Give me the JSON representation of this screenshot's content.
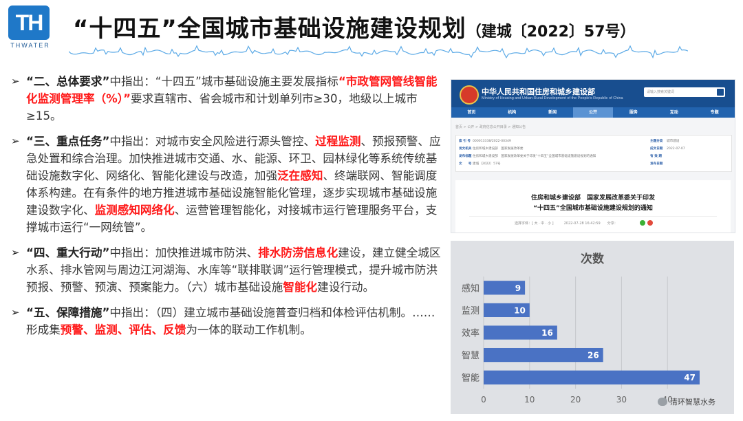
{
  "logo": {
    "mark": "TH",
    "text": "THWATER",
    "color": "#1f78c8"
  },
  "title": {
    "main": "“十四五”全国城市基础设施建设规划",
    "sub": "（建城〔2022〕57号）"
  },
  "paragraphs": [
    [
      {
        "t": "“二、总体要求”",
        "s": "bold"
      },
      {
        "t": "中指出：“十四五”城市基础设施主要发展指标",
        "s": ""
      },
      {
        "t": "“市政管网管线智能化监测管理率（%）”",
        "s": "red"
      },
      {
        "t": "要求直辖市、省会城市和计划单列市≥30，地级以上城市≥15。",
        "s": ""
      }
    ],
    [
      {
        "t": "“三、重点任务”",
        "s": "bold"
      },
      {
        "t": "中指出：对城市安全风险进行源头管控、",
        "s": ""
      },
      {
        "t": "过程监测",
        "s": "red"
      },
      {
        "t": "、预报预警、应急处置和综合治理。加快推进城市交通、水、能源、环卫、园林绿化等系统传统基础设施数字化、网络化、智能化建设与改造，加强",
        "s": ""
      },
      {
        "t": "泛在感知",
        "s": "red"
      },
      {
        "t": "、终端联网、智能调度体系构建。在有条件的地方推进城市基础设施智能化管理，逐步实现城市基础设施建设数字化、",
        "s": ""
      },
      {
        "t": "监测感知网络化",
        "s": "red"
      },
      {
        "t": "、运营管理智能化，对接城市运行管理服务平台，支撑城市运行“一网统管”。",
        "s": ""
      }
    ],
    [
      {
        "t": "“四、重大行动”",
        "s": "bold"
      },
      {
        "t": "中指出：加快推进城市防洪、",
        "s": ""
      },
      {
        "t": "排水防涝信息化",
        "s": "red"
      },
      {
        "t": "建设，建立健全城区水系、排水管网与周边江河湖海、水库等“联排联调”运行管理模式，提升城市防洪预报、预警、预演、预案能力。（六）城市基础设施",
        "s": ""
      },
      {
        "t": "智能化",
        "s": "red"
      },
      {
        "t": "建设行动。",
        "s": ""
      }
    ],
    [
      {
        "t": "“五、保障措施”",
        "s": "bold"
      },
      {
        "t": "中指出：（四）建立城市基础设施普查归档和体检评估机制。……形成集",
        "s": ""
      },
      {
        "t": "预警、监测、评估、反馈",
        "s": "red"
      },
      {
        "t": "为一体的联动工作机制。",
        "s": ""
      }
    ]
  ],
  "screenshot": {
    "site_title": "中华人民共和国住房和城乡建设部",
    "site_subtitle": "Ministry of Housing and Urban-Rural Development of the People's Republic of China",
    "search_placeholder": "请输入搜索关键词",
    "nav": [
      "首页",
      "机构",
      "新闻",
      "公开",
      "服务",
      "互动",
      "专题"
    ],
    "nav_active": 3,
    "breadcrumb": "首页 > 公开 > 政府信息公开目录 > 通知公告",
    "meta": [
      {
        "l": "索 引 号",
        "v": "000013338/2022-00349",
        "rl": "主题分类",
        "rv": "城市建设"
      },
      {
        "l": "发文机关",
        "v": "住房和城乡建设部　国家发展改革委",
        "rl": "成文日期",
        "rv": "2022-07-07"
      },
      {
        "l": "发布标题",
        "v": "住房和城乡建设部　国家发展改革委关于印发“十四五”全国城市基础设施建设规划的通知",
        "rl": "有 效 期",
        "rv": ""
      },
      {
        "l": "文　　号",
        "v": "建城〔2022〕57号",
        "rl": "发布日期",
        "rv": ""
      }
    ],
    "doc_title_1": "住房和城乡建设部　国家发展改革委关于印发",
    "doc_title_2": "“十四五”全国城市基础设施建设规划的通知",
    "doc_info": "选择字体：[ 大 · 中 · 小 ]　　　2022-07-28 16:42:59　　分享："
  },
  "chart_data": {
    "type": "bar",
    "orientation": "horizontal",
    "title": "次数",
    "categories": [
      "感知",
      "监测",
      "效率",
      "智慧",
      "智能"
    ],
    "values": [
      9,
      10,
      16,
      26,
      47
    ],
    "xlim": [
      0,
      50
    ],
    "xticks": [
      0,
      10,
      20,
      30,
      40
    ],
    "grid": true,
    "bar_color": "#4a72c4",
    "data_labels": true
  },
  "watermark": "清环智慧水务"
}
